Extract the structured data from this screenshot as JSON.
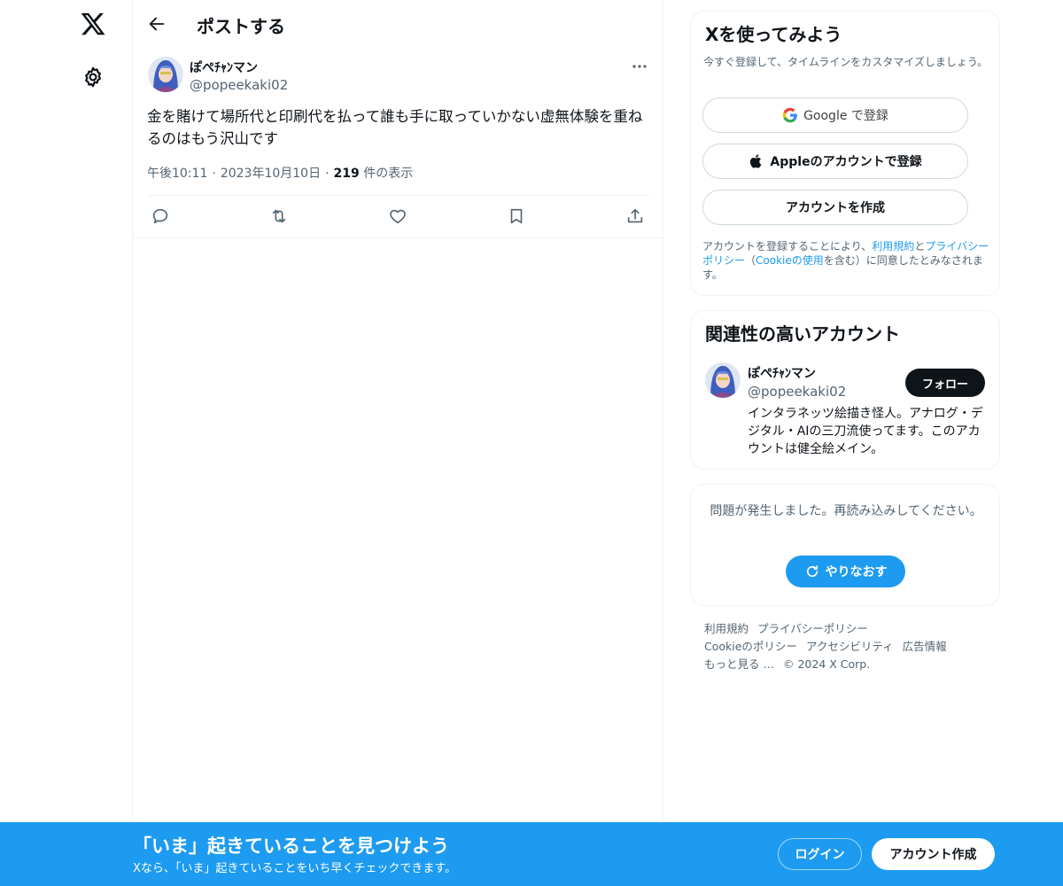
{
  "header": {
    "title": "ポストする"
  },
  "post": {
    "author_name": "ぽぺﾁｬﾝマン",
    "author_handle": "@popeekaki02",
    "text": "金を賭けて場所代と印刷代を払って誰も手に取っていかない虚無体験を重ねるのはもう沢山です",
    "time": "午後10:11",
    "date": "2023年10月10日",
    "views": "219",
    "views_label": "件の表示"
  },
  "signup": {
    "title": "Xを使ってみよう",
    "subtitle": "今すぐ登録して、タイムラインをカスタマイズしましょう。",
    "google_button": "Google で登録",
    "apple_button": "Appleのアカウントで登録",
    "create_button": "アカウントを作成",
    "legal_prefix": "アカウントを登録することにより、",
    "legal_terms": "利用規約",
    "legal_and": "と",
    "legal_privacy": "プライバシーポリシー",
    "legal_paren_open": "（",
    "legal_cookie": "Cookieの使用",
    "legal_suffix": "を含む）に同意したとみなされます。"
  },
  "related": {
    "title": "関連性の高いアカウント",
    "name": "ぽぺﾁｬﾝマン",
    "handle": "@popeekaki02",
    "follow_button": "フォロー",
    "bio": "インタラネッツ絵描き怪人。アナログ・デジタル・AIの三刀流使ってます。このアカウントは健全絵メイン。"
  },
  "error": {
    "message": "問題が発生しました。再読み込みしてください。",
    "retry_button": "やりなおす"
  },
  "footer": {
    "terms": "利用規約",
    "privacy": "プライバシーポリシー",
    "cookie": "Cookieのポリシー",
    "accessibility": "アクセシビリティ",
    "ads": "広告情報",
    "more": "もっと見る …",
    "copyright": "© 2024 X Corp."
  },
  "bottom_bar": {
    "title": "「いま」起きていることを見つけよう",
    "subtitle": "Xなら、「いま」起きていることをいち早くチェックできます。",
    "login_button": "ログイン",
    "signup_button": "アカウント作成"
  },
  "colors": {
    "accent": "#1d9bf0",
    "text": "#0f1419",
    "secondary": "#536471",
    "border": "#eff3f4"
  }
}
